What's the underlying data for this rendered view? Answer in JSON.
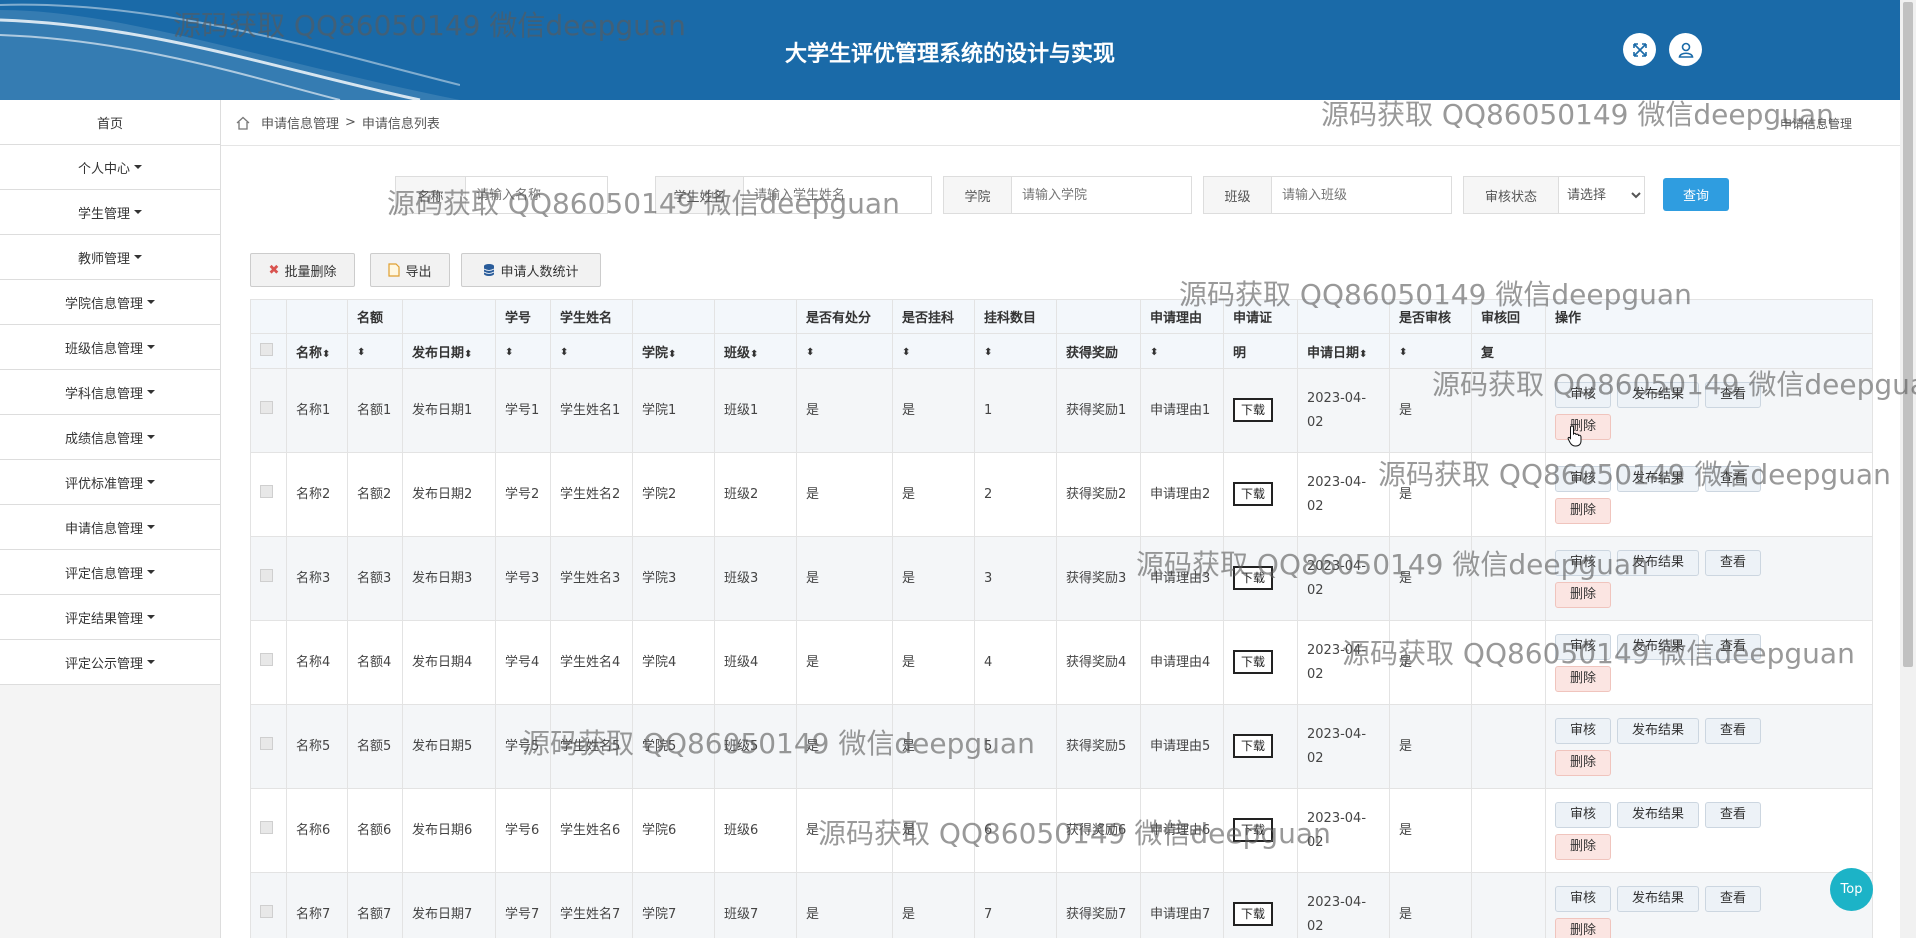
{
  "header": {
    "title": "大学生评优管理系统的设计与实现"
  },
  "sidebar": {
    "items": [
      {
        "label": "首页",
        "dropdown": false
      },
      {
        "label": "个人中心",
        "dropdown": true
      },
      {
        "label": "学生管理",
        "dropdown": true
      },
      {
        "label": "教师管理",
        "dropdown": true
      },
      {
        "label": "学院信息管理",
        "dropdown": true
      },
      {
        "label": "班级信息管理",
        "dropdown": true
      },
      {
        "label": "学科信息管理",
        "dropdown": true
      },
      {
        "label": "成绩信息管理",
        "dropdown": true
      },
      {
        "label": "评优标准管理",
        "dropdown": true
      },
      {
        "label": "申请信息管理",
        "dropdown": true
      },
      {
        "label": "评定信息管理",
        "dropdown": true
      },
      {
        "label": "评定结果管理",
        "dropdown": true
      },
      {
        "label": "评定公示管理",
        "dropdown": true
      }
    ]
  },
  "breadcrumb": {
    "parent": "申请信息管理",
    "separator": ">",
    "current": "申请信息列表",
    "right": "申请信息管理"
  },
  "search": {
    "name_label": "名称",
    "name_placeholder": "请输入名称",
    "student_label": "学生姓名",
    "student_placeholder": "请输入学生姓名",
    "college_label": "学院",
    "college_placeholder": "请输入学院",
    "class_label": "班级",
    "class_placeholder": "请输入班级",
    "status_label": "审核状态",
    "status_value": "请选择",
    "query_label": "查询"
  },
  "actions": {
    "batch_delete": "批量删除",
    "export": "导出",
    "stats": "申请人数统计"
  },
  "table": {
    "header_top": [
      "",
      "",
      "名额",
      "",
      "学号",
      "学生姓名",
      "",
      "",
      "是否有处分",
      "是否挂科",
      "挂科数目",
      "",
      "申请理由",
      "申请证",
      "",
      "是否审核",
      "审核回",
      "操作"
    ],
    "header_bottom": [
      "",
      "名称",
      "",
      "发布日期",
      "",
      "",
      "学院",
      "班级",
      "",
      "",
      "",
      "获得奖励",
      "",
      "明",
      "申请日期",
      "",
      "复",
      ""
    ],
    "sortable_bottom": [
      false,
      true,
      true,
      true,
      true,
      true,
      true,
      true,
      true,
      true,
      true,
      false,
      true,
      false,
      true,
      true,
      false,
      false
    ],
    "rows": [
      {
        "name": "名称1",
        "quota": "名额1",
        "date": "发布日期1",
        "sid": "学号1",
        "sname": "学生姓名1",
        "college": "学院1",
        "class": "班级1",
        "punish": "是",
        "fail": "是",
        "failnum": "1",
        "award": "获得奖励1",
        "reason": "申请理由1",
        "cert": "下载",
        "apply_date": "2023-04-02",
        "reviewed": "是",
        "reply": ""
      },
      {
        "name": "名称2",
        "quota": "名额2",
        "date": "发布日期2",
        "sid": "学号2",
        "sname": "学生姓名2",
        "college": "学院2",
        "class": "班级2",
        "punish": "是",
        "fail": "是",
        "failnum": "2",
        "award": "获得奖励2",
        "reason": "申请理由2",
        "cert": "下载",
        "apply_date": "2023-04-02",
        "reviewed": "是",
        "reply": ""
      },
      {
        "name": "名称3",
        "quota": "名额3",
        "date": "发布日期3",
        "sid": "学号3",
        "sname": "学生姓名3",
        "college": "学院3",
        "class": "班级3",
        "punish": "是",
        "fail": "是",
        "failnum": "3",
        "award": "获得奖励3",
        "reason": "申请理由3",
        "cert": "下载",
        "apply_date": "2023-04-02",
        "reviewed": "是",
        "reply": ""
      },
      {
        "name": "名称4",
        "quota": "名额4",
        "date": "发布日期4",
        "sid": "学号4",
        "sname": "学生姓名4",
        "college": "学院4",
        "class": "班级4",
        "punish": "是",
        "fail": "是",
        "failnum": "4",
        "award": "获得奖励4",
        "reason": "申请理由4",
        "cert": "下载",
        "apply_date": "2023-04-02",
        "reviewed": "是",
        "reply": ""
      },
      {
        "name": "名称5",
        "quota": "名额5",
        "date": "发布日期5",
        "sid": "学号5",
        "sname": "学生姓名5",
        "college": "学院5",
        "class": "班级5",
        "punish": "是",
        "fail": "是",
        "failnum": "5",
        "award": "获得奖励5",
        "reason": "申请理由5",
        "cert": "下载",
        "apply_date": "2023-04-02",
        "reviewed": "是",
        "reply": ""
      },
      {
        "name": "名称6",
        "quota": "名额6",
        "date": "发布日期6",
        "sid": "学号6",
        "sname": "学生姓名6",
        "college": "学院6",
        "class": "班级6",
        "punish": "是",
        "fail": "是",
        "failnum": "6",
        "award": "获得奖励6",
        "reason": "申请理由6",
        "cert": "下载",
        "apply_date": "2023-04-02",
        "reviewed": "是",
        "reply": ""
      },
      {
        "name": "名称7",
        "quota": "名额7",
        "date": "发布日期7",
        "sid": "学号7",
        "sname": "学生姓名7",
        "college": "学院7",
        "class": "班级7",
        "punish": "是",
        "fail": "是",
        "failnum": "7",
        "award": "获得奖励7",
        "reason": "申请理由7",
        "cert": "下载",
        "apply_date": "2023-04-02",
        "reviewed": "是",
        "reply": ""
      }
    ],
    "op_labels": {
      "review": "审核",
      "publish": "发布结果",
      "view": "查看",
      "delete": "删除"
    }
  },
  "top_button": "Top",
  "watermark": "源码获取 QQ86050149 微信deepguan",
  "colors": {
    "header_bg": "#1a6aa8",
    "query_btn": "#2f9de0",
    "top_btn": "#1cb3c7"
  },
  "icons": {
    "fullscreen": "expand-icon",
    "user": "user-icon",
    "home": "home-icon"
  }
}
